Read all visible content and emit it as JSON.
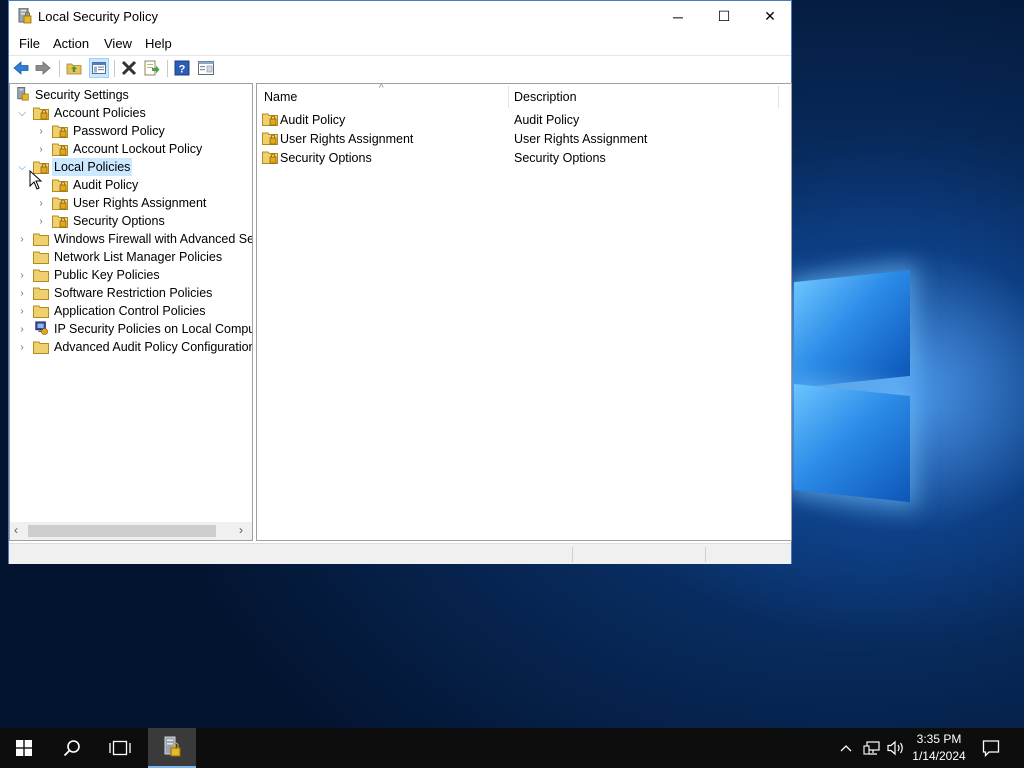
{
  "window": {
    "title": "Local Security Policy",
    "controls": {
      "minimize": "─",
      "maximize": "☐",
      "close": "✕"
    }
  },
  "menu": [
    "File",
    "Action",
    "View",
    "Help"
  ],
  "toolbar": [
    "back-icon",
    "forward-icon",
    "up-folder-icon",
    "show-hide-tree-icon",
    "delete-icon",
    "export-list-icon",
    "help-icon",
    "properties-icon"
  ],
  "tree": {
    "root": "Security Settings",
    "items": [
      {
        "label": "Account Policies",
        "expanded": true
      },
      {
        "label": "Password Policy"
      },
      {
        "label": "Account Lockout Policy"
      },
      {
        "label": "Local Policies",
        "expanded": true,
        "selected": true
      },
      {
        "label": "Audit Policy"
      },
      {
        "label": "User Rights Assignment"
      },
      {
        "label": "Security Options"
      },
      {
        "label": "Windows Firewall with Advanced Security"
      },
      {
        "label": "Network List Manager Policies"
      },
      {
        "label": "Public Key Policies"
      },
      {
        "label": "Software Restriction Policies"
      },
      {
        "label": "Application Control Policies"
      },
      {
        "label": "IP Security Policies on Local Computer"
      },
      {
        "label": "Advanced Audit Policy Configuration"
      }
    ]
  },
  "list": {
    "columns": [
      "Name",
      "Description"
    ],
    "rows": [
      {
        "name": "Audit Policy",
        "description": "Audit Policy"
      },
      {
        "name": "User Rights Assignment",
        "description": "User Rights Assignment"
      },
      {
        "name": "Security Options",
        "description": "Security Options"
      }
    ]
  },
  "taskbar": {
    "time": "3:35 PM",
    "date": "1/14/2024"
  },
  "colors": {
    "selection": "#cce8ff",
    "titlebar_border": "#4a7ab8",
    "taskbar": "#0d0d0d"
  }
}
